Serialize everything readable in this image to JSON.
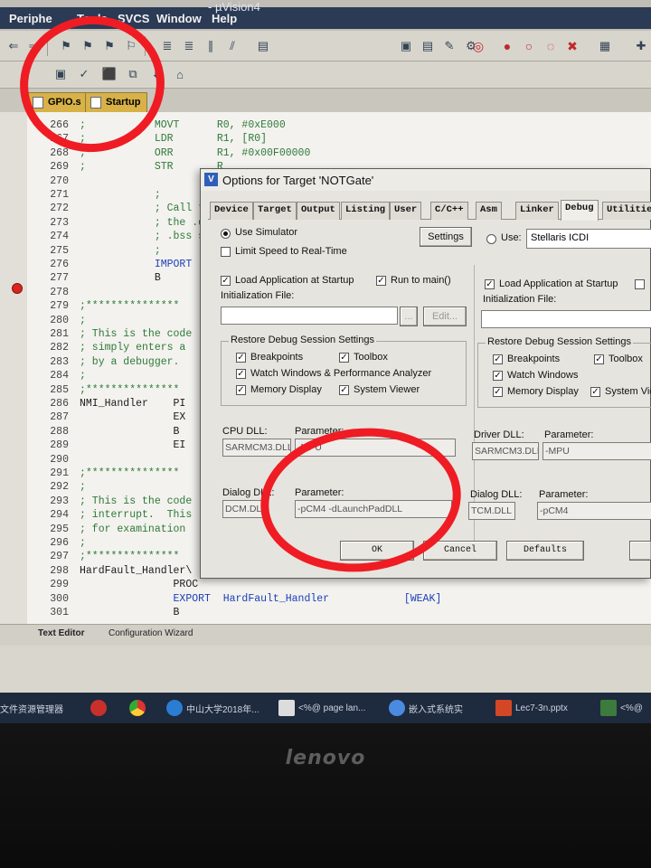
{
  "menubar": {
    "items": [
      "Periphe",
      "Tools",
      "SVCS",
      "Window",
      "Help"
    ],
    "window_title": "- µVision4"
  },
  "toolbar": {
    "icons": [
      "back-icon",
      "indent-icon",
      "bookmark-icon",
      "debug-icon",
      "build-icon",
      "search-icon",
      "breakpoint-icon",
      "settings-icon"
    ]
  },
  "file_tabs": [
    "GPIO.s",
    "Startup"
  ],
  "editor": {
    "lines": [
      {
        "n": "266",
        "code": ";           MOVT      R0, #0xE000"
      },
      {
        "n": "267",
        "code": ";           LDR       R1, [R0]"
      },
      {
        "n": "268",
        "code": ";           ORR       R1, #0x00F00000"
      },
      {
        "n": "269",
        "code": ";           STR       R"
      },
      {
        "n": "270",
        "code": ""
      },
      {
        "n": "271",
        "code": "            ;"
      },
      {
        "n": "272",
        "code": "            ; Call the"
      },
      {
        "n": "273",
        "code": "            ; the .dat"
      },
      {
        "n": "274",
        "code": "            ; .bss sec"
      },
      {
        "n": "275",
        "code": "            ;"
      },
      {
        "n": "276",
        "code": "            IMPORT  St"
      },
      {
        "n": "277",
        "code": "            B       St"
      },
      {
        "n": "278",
        "code": ""
      },
      {
        "n": "279",
        "code": ";***************"
      },
      {
        "n": "280",
        "code": ";"
      },
      {
        "n": "281",
        "code": "; This is the code"
      },
      {
        "n": "282",
        "code": "; simply enters a"
      },
      {
        "n": "283",
        "code": "; by a debugger."
      },
      {
        "n": "284",
        "code": ";"
      },
      {
        "n": "285",
        "code": ";***************"
      },
      {
        "n": "286",
        "code": "NMI_Handler    PI"
      },
      {
        "n": "287",
        "code": "               EX"
      },
      {
        "n": "288",
        "code": "               B"
      },
      {
        "n": "289",
        "code": "               EI"
      },
      {
        "n": "290",
        "code": ""
      },
      {
        "n": "291",
        "code": ";***************"
      },
      {
        "n": "292",
        "code": ";"
      },
      {
        "n": "293",
        "code": "; This is the code"
      },
      {
        "n": "294",
        "code": "; interrupt.  This"
      },
      {
        "n": "295",
        "code": "; for examination"
      },
      {
        "n": "296",
        "code": ";"
      },
      {
        "n": "297",
        "code": ";***************"
      },
      {
        "n": "298",
        "code": "HardFault_Handler\\"
      },
      {
        "n": "299",
        "code": "               PROC"
      },
      {
        "n": "300",
        "code": "               EXPORT  HardFault_Handler            [WEAK]"
      },
      {
        "n": "301",
        "code": "               B"
      }
    ]
  },
  "bottom_tabs": [
    "Text Editor",
    "Configuration Wizard"
  ],
  "taskbar": {
    "items": [
      "文件资源管理器",
      "",
      "",
      "中山大学2018年...",
      "<%@ page lan...",
      "嵌入式系统实",
      "Lec7-3n.pptx",
      "<%@"
    ]
  },
  "dialog": {
    "title": "Options for Target 'NOTGate'",
    "tabs": [
      "Device",
      "Target",
      "Output",
      "Listing",
      "User",
      "C/C++",
      "Asm",
      "Linker",
      "Debug",
      "Utilities"
    ],
    "active_tab": "Debug",
    "left": {
      "use_simulator": "Use Simulator",
      "limit_speed": "Limit Speed to Real-Time",
      "settings_button": "Settings",
      "load_app": "Load Application at Startup",
      "run_to_main": "Run to main()",
      "init_file_label": "Initialization File:",
      "browse_button": "...",
      "edit_button": "Edit...",
      "restore_group": "Restore Debug Session Settings",
      "breakpoints": "Breakpoints",
      "toolbox": "Toolbox",
      "watch_windows": "Watch Windows & Performance Analyzer",
      "memory_display": "Memory Display",
      "system_viewer": "System Viewer",
      "cpu_dll_label": "CPU DLL:",
      "cpu_dll_value": "SARMCM3.DLL",
      "cpu_param_label": "Parameter:",
      "cpu_param_value": "-MPU",
      "dialog_dll_label": "Dialog DLL:",
      "dialog_dll_value": "DCM.DLL",
      "dialog_param_label": "Parameter:",
      "dialog_param_value": "-pCM4 -dLaunchPadDLL"
    },
    "right": {
      "use_label": "Use:",
      "use_value": "Stellaris ICDI",
      "load_app": "Load Application at Startup",
      "init_file_label": "Initialization File:",
      "restore_group": "Restore Debug Session Settings",
      "breakpoints": "Breakpoints",
      "toolbox": "Toolbox",
      "watch_windows": "Watch Windows",
      "memory_display": "Memory Display",
      "system_viewer": "System Viev",
      "driver_dll_label": "Driver DLL:",
      "driver_dll_value": "SARMCM3.DLL",
      "driver_param_label": "Parameter:",
      "driver_param_value": "-MPU",
      "dialog_dll_label": "Dialog DLL:",
      "dialog_dll_value": "TCM.DLL",
      "dialog_param_label": "Parameter:",
      "dialog_param_value": "-pCM4"
    },
    "buttons": {
      "ok": "OK",
      "cancel": "Cancel",
      "defaults": "Defaults"
    }
  },
  "bezel": {
    "brand": "lenovo"
  },
  "annotations": {
    "color": "#ef1c24"
  }
}
